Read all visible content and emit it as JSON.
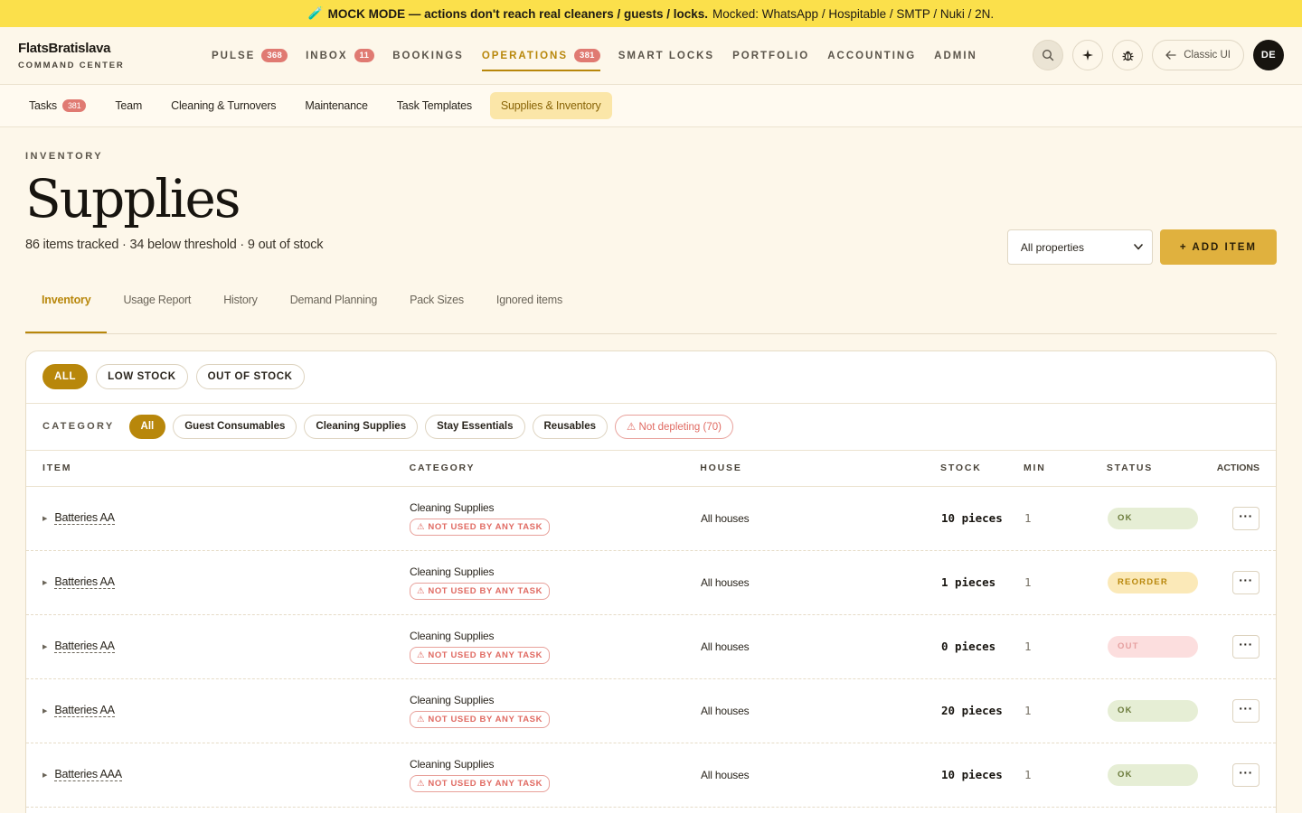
{
  "banner": {
    "icon": "test-tube-icon",
    "emoji": "🧪",
    "bold_text": "MOCK MODE — actions don't reach real cleaners / guests / locks.",
    "text": "Mocked: WhatsApp / Hospitable / SMTP / Nuki / 2N."
  },
  "brand": {
    "name": "FlatsBratislava",
    "subtitle": "COMMAND CENTER"
  },
  "nav": {
    "items": [
      {
        "label": "PULSE",
        "badge": "368"
      },
      {
        "label": "INBOX",
        "badge": "11"
      },
      {
        "label": "BOOKINGS",
        "badge": ""
      },
      {
        "label": "OPERATIONS",
        "badge": "381",
        "active": true
      },
      {
        "label": "SMART LOCKS",
        "badge": ""
      },
      {
        "label": "PORTFOLIO",
        "badge": ""
      },
      {
        "label": "ACCOUNTING",
        "badge": ""
      },
      {
        "label": "ADMIN",
        "badge": ""
      }
    ],
    "classic_label": "Classic UI",
    "avatar": "DE"
  },
  "subnav": {
    "items": [
      {
        "label": "Tasks",
        "badge": "381"
      },
      {
        "label": "Team"
      },
      {
        "label": "Cleaning & Turnovers"
      },
      {
        "label": "Maintenance"
      },
      {
        "label": "Task Templates"
      },
      {
        "label": "Supplies & Inventory",
        "active": true
      }
    ]
  },
  "header": {
    "eyebrow": "INVENTORY",
    "title": "Supplies",
    "subtitle": "86 items tracked · 34 below threshold · 9 out of stock",
    "property_select": "All properties",
    "add_button": "+ ADD ITEM"
  },
  "tabs": [
    "Inventory",
    "Usage Report",
    "History",
    "Demand Planning",
    "Pack Sizes",
    "Ignored items"
  ],
  "stock_filters": [
    "ALL",
    "LOW STOCK",
    "OUT OF STOCK"
  ],
  "category_filters": {
    "label": "CATEGORY",
    "items": [
      "All",
      "Guest Consumables",
      "Cleaning Supplies",
      "Stay Essentials",
      "Reusables"
    ],
    "warn": "⚠ Not depleting (70)"
  },
  "table": {
    "headers": {
      "item": "ITEM",
      "category": "CATEGORY",
      "house": "HOUSE",
      "stock": "STOCK",
      "min": "MIN",
      "status": "STATUS",
      "actions": "ACTIONS"
    },
    "not_used_label": "⚠ NOT USED BY ANY TASK",
    "rows": [
      {
        "item": "Batteries AA",
        "category": "Cleaning Supplies",
        "house": "All houses",
        "stock": "10 pieces",
        "min": "1",
        "status": "OK",
        "status_kind": "ok"
      },
      {
        "item": "Batteries AA",
        "category": "Cleaning Supplies",
        "house": "All houses",
        "stock": "1 pieces",
        "min": "1",
        "status": "REORDER",
        "status_kind": "reorder"
      },
      {
        "item": "Batteries AA",
        "category": "Cleaning Supplies",
        "house": "All houses",
        "stock": "0 pieces",
        "min": "1",
        "status": "OUT",
        "status_kind": "out"
      },
      {
        "item": "Batteries AA",
        "category": "Cleaning Supplies",
        "house": "All houses",
        "stock": "20 pieces",
        "min": "1",
        "status": "OK",
        "status_kind": "ok"
      },
      {
        "item": "Batteries AAA",
        "category": "Cleaning Supplies",
        "house": "All houses",
        "stock": "10 pieces",
        "min": "1",
        "status": "OK",
        "status_kind": "ok"
      }
    ]
  }
}
